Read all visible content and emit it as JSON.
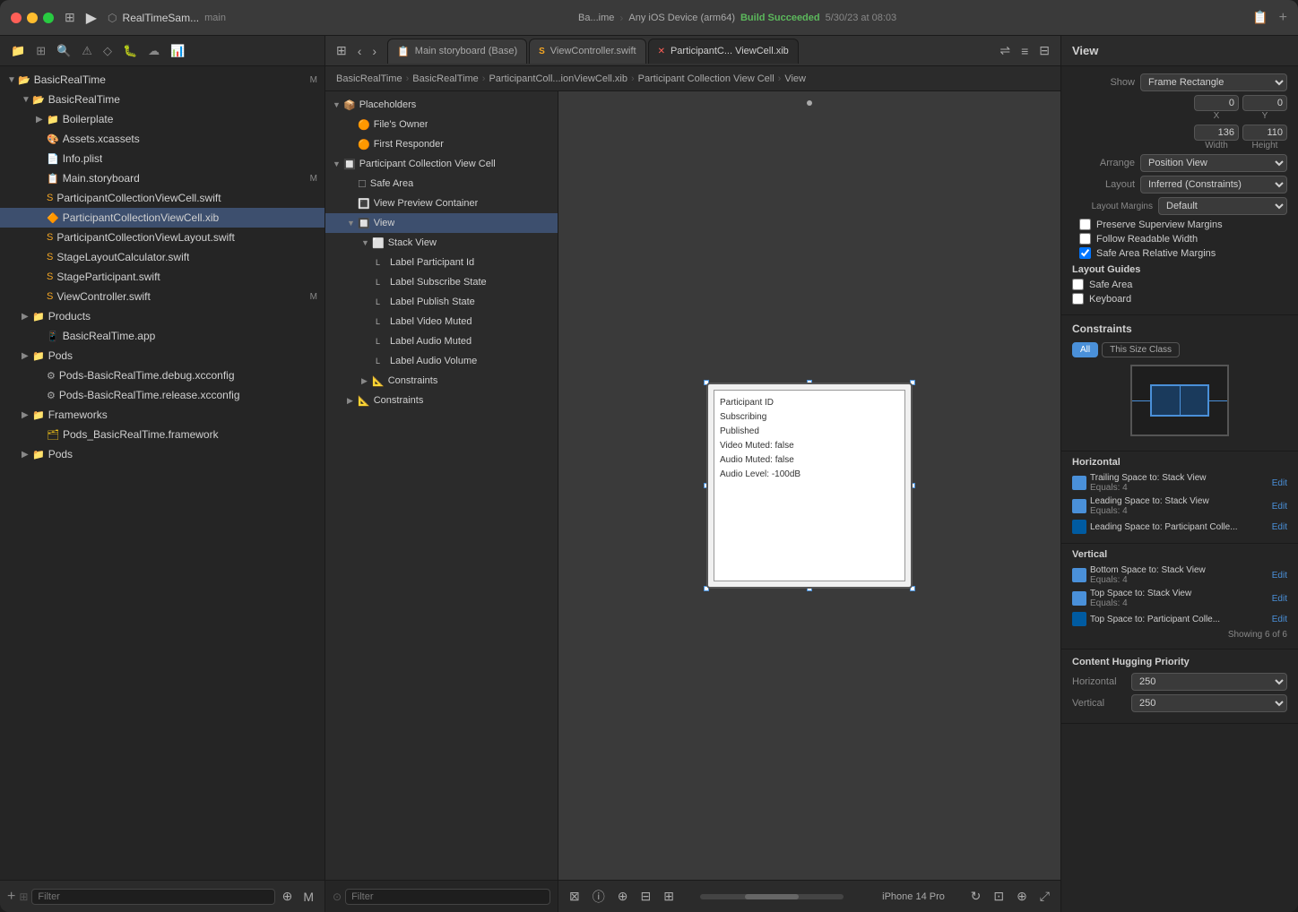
{
  "window": {
    "title": "RealTimeSam... — main"
  },
  "traffic_lights": {
    "red": "close",
    "yellow": "minimize",
    "green": "maximize"
  },
  "top_toolbar": {
    "run_label": "▶",
    "scheme": "RealTimeSam...",
    "branch": "main",
    "device": "Ba...ime",
    "any_ios": "Any iOS Device (arm64)",
    "build_status": "Build Succeeded",
    "build_date": "5/30/23 at 08:03",
    "add_label": "+"
  },
  "tabs": [
    {
      "label": "Main storyboard (Base)",
      "closable": false,
      "active": false,
      "icon": "📋"
    },
    {
      "label": "ViewController.swift",
      "closable": false,
      "active": false,
      "icon": "S"
    },
    {
      "label": "ParticipantC... ViewCell.xib",
      "closable": true,
      "active": true,
      "icon": "✕"
    }
  ],
  "breadcrumb": {
    "items": [
      "BasicRealTime",
      "BasicRealTime",
      "ParticipantColl...ionViewCell.xib",
      "Participant Collection View Cell",
      "View"
    ]
  },
  "left_sidebar": {
    "title": "Project Navigator",
    "items": [
      {
        "label": "BasicRealTime",
        "indent": 0,
        "disc": "▼",
        "icon": "📁",
        "badge": ""
      },
      {
        "label": "BasicRealTime",
        "indent": 1,
        "disc": "▼",
        "icon": "📁",
        "badge": ""
      },
      {
        "label": "Boilerplate",
        "indent": 2,
        "disc": "▶",
        "icon": "📁",
        "badge": ""
      },
      {
        "label": "Assets.xcassets",
        "indent": 2,
        "disc": "",
        "icon": "🎨",
        "badge": ""
      },
      {
        "label": "Info.plist",
        "indent": 2,
        "disc": "",
        "icon": "📄",
        "badge": ""
      },
      {
        "label": "Main.storyboard",
        "indent": 2,
        "disc": "",
        "icon": "📋",
        "badge": "M"
      },
      {
        "label": "ParticipantCollectionViewCell.swift",
        "indent": 2,
        "disc": "",
        "icon": "S",
        "badge": ""
      },
      {
        "label": "ParticipantCollectionViewCell.xib",
        "indent": 2,
        "disc": "",
        "icon": "🔶",
        "badge": "",
        "selected": true
      },
      {
        "label": "ParticipantCollectionViewLayout.swift",
        "indent": 2,
        "disc": "",
        "icon": "S",
        "badge": ""
      },
      {
        "label": "StageLayoutCalculator.swift",
        "indent": 2,
        "disc": "",
        "icon": "S",
        "badge": ""
      },
      {
        "label": "StageParticipant.swift",
        "indent": 2,
        "disc": "",
        "icon": "S",
        "badge": ""
      },
      {
        "label": "ViewController.swift",
        "indent": 2,
        "disc": "",
        "icon": "S",
        "badge": "M"
      },
      {
        "label": "Products",
        "indent": 1,
        "disc": "▶",
        "icon": "📁",
        "badge": ""
      },
      {
        "label": "BasicRealTime.app",
        "indent": 2,
        "disc": "",
        "icon": "📱",
        "badge": ""
      },
      {
        "label": "Pods",
        "indent": 1,
        "disc": "▶",
        "icon": "📁",
        "badge": ""
      },
      {
        "label": "Pods-BasicRealTime.debug.xcconfig",
        "indent": 2,
        "disc": "",
        "icon": "⚙️",
        "badge": ""
      },
      {
        "label": "Pods-BasicRealTime.release.xcconfig",
        "indent": 2,
        "disc": "",
        "icon": "⚙️",
        "badge": ""
      },
      {
        "label": "Frameworks",
        "indent": 1,
        "disc": "▶",
        "icon": "📁",
        "badge": ""
      },
      {
        "label": "Pods_BasicRealTime.framework",
        "indent": 2,
        "disc": "",
        "icon": "🗂️",
        "badge": ""
      },
      {
        "label": "Pods",
        "indent": 1,
        "disc": "▶",
        "icon": "📁",
        "badge": ""
      }
    ],
    "filter_placeholder": "Filter"
  },
  "tree_panel": {
    "items": [
      {
        "label": "Placeholders",
        "indent": 0,
        "disc": "▼",
        "icon": "📦",
        "selected": false
      },
      {
        "label": "File's Owner",
        "indent": 1,
        "disc": "",
        "icon": "🟠",
        "selected": false
      },
      {
        "label": "First Responder",
        "indent": 1,
        "disc": "",
        "icon": "🟠",
        "selected": false
      },
      {
        "label": "Participant Collection View Cell",
        "indent": 0,
        "disc": "▼",
        "icon": "🔲",
        "selected": false
      },
      {
        "label": "Safe Area",
        "indent": 1,
        "disc": "",
        "icon": "☐",
        "selected": false
      },
      {
        "label": "View Preview Container",
        "indent": 1,
        "disc": "",
        "icon": "🔳",
        "selected": false
      },
      {
        "label": "View",
        "indent": 1,
        "disc": "▼",
        "icon": "🔲",
        "selected": true
      },
      {
        "label": "Stack View",
        "indent": 2,
        "disc": "▼",
        "icon": "⬜",
        "selected": false
      },
      {
        "label": "Label Participant Id",
        "indent": 3,
        "disc": "",
        "icon": "L",
        "selected": false
      },
      {
        "label": "Label Subscribe State",
        "indent": 3,
        "disc": "",
        "icon": "L",
        "selected": false
      },
      {
        "label": "Label Publish State",
        "indent": 3,
        "disc": "",
        "icon": "L",
        "selected": false
      },
      {
        "label": "Label Video Muted",
        "indent": 3,
        "disc": "",
        "icon": "L",
        "selected": false
      },
      {
        "label": "Label Audio Muted",
        "indent": 3,
        "disc": "",
        "icon": "L",
        "selected": false
      },
      {
        "label": "Label Audio Volume",
        "indent": 3,
        "disc": "",
        "icon": "L",
        "selected": false
      },
      {
        "label": "Constraints",
        "indent": 2,
        "disc": "▶",
        "icon": "📐",
        "selected": false
      },
      {
        "label": "Constraints",
        "indent": 1,
        "disc": "▶",
        "icon": "📐",
        "selected": false
      }
    ],
    "filter_placeholder": "Filter"
  },
  "canvas": {
    "cell_labels": [
      "Participant ID",
      "Subscribing",
      "Published",
      "Video Muted: false",
      "Audio Muted: false",
      "Audio Level: -100dB"
    ]
  },
  "canvas_toolbar": {
    "device_label": "iPhone 14 Pro"
  },
  "right_panel": {
    "title": "View",
    "show_label": "Show",
    "show_value": "Frame Rectangle",
    "x_value": "0",
    "y_value": "0",
    "width_value": "136",
    "height_value": "110",
    "arrange_label": "Arrange",
    "arrange_value": "Position View",
    "layout_label": "Layout",
    "layout_value": "Inferred (Constraints)",
    "layout_margins_label": "Layout Margins",
    "layout_margins_value": "Default",
    "preserve_superview_margins": false,
    "follow_readable_width": false,
    "safe_area_relative_margins": true,
    "layout_guides_title": "Layout Guides",
    "safe_area": false,
    "keyboard": false,
    "constraints_title": "Constraints",
    "tabs": [
      "All",
      "This Size Class"
    ],
    "active_tab": "All",
    "horizontal_title": "Horizontal",
    "h_constraints": [
      {
        "text": "Trailing Space to:  Stack View",
        "sub": "Equals: 4",
        "edit": "Edit"
      },
      {
        "text": "Leading Space to:  Stack View",
        "sub": "Equals: 4",
        "edit": "Edit"
      },
      {
        "text": "Leading Space to:  Participant Colle...",
        "sub": "",
        "edit": "Edit"
      }
    ],
    "vertical_title": "Vertical",
    "v_constraints": [
      {
        "text": "Bottom Space to:  Stack View",
        "sub": "Equals: 4",
        "edit": "Edit"
      },
      {
        "text": "Top Space to:  Stack View",
        "sub": "Equals: 4",
        "edit": "Edit"
      },
      {
        "text": "Top Space to:  Participant Colle...",
        "sub": "",
        "edit": "Edit"
      }
    ],
    "showing_label": "Showing 6 of 6",
    "content_hugging_title": "Content Hugging Priority",
    "horizontal_priority_label": "Horizontal",
    "horizontal_priority_value": "250",
    "vertical_priority_label": "Vertical",
    "vertical_priority_value": "250"
  }
}
